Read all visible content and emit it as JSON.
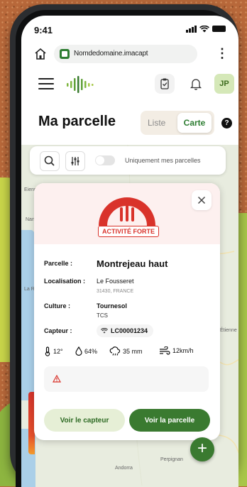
{
  "status": {
    "time": "9:41"
  },
  "browser": {
    "url": "Nomdedomaine.imacapt"
  },
  "header": {
    "avatar_initials": "JP"
  },
  "page": {
    "title": "Ma parcelle",
    "view_toggle": {
      "list_label": "Liste",
      "map_label": "Carte",
      "selected": "Carte"
    },
    "help_glyph": "?"
  },
  "filter": {
    "only_my_parcels_label": "Uniquement mes parcelles",
    "only_my_parcels_on": false
  },
  "map": {
    "labels": {
      "city1": "Nantes",
      "city2": "Eiennes",
      "city3": "Andorra",
      "city4": "Perpignan",
      "city5": "La Rochelle",
      "city6": "Étienne"
    }
  },
  "card": {
    "activity_label": "ACTIVITÉ FORTE",
    "activity_color": "#d9332b",
    "parcel_label": "Parcelle :",
    "parcel_name": "Montrejeau haut",
    "location_label": "Localisation :",
    "location_value": "Le Fousseret",
    "postal_value": "31430, FRANCE",
    "crop_label": "Culture :",
    "crop_value": "Tournesol",
    "crop_sub": "TCS",
    "sensor_label": "Capteur :",
    "sensor_id": "LC00001234",
    "weather": {
      "temperature": "12°",
      "humidity": "64%",
      "rain": "35 mm",
      "wind": "12km/h"
    },
    "btn_sensor": "Voir le capteur",
    "btn_parcel": "Voir la parcelle"
  },
  "fab_glyph": "+",
  "colors": {
    "brand_green": "#3a7a30",
    "light_green": "#e6efd6",
    "alert_red": "#d9332b"
  }
}
